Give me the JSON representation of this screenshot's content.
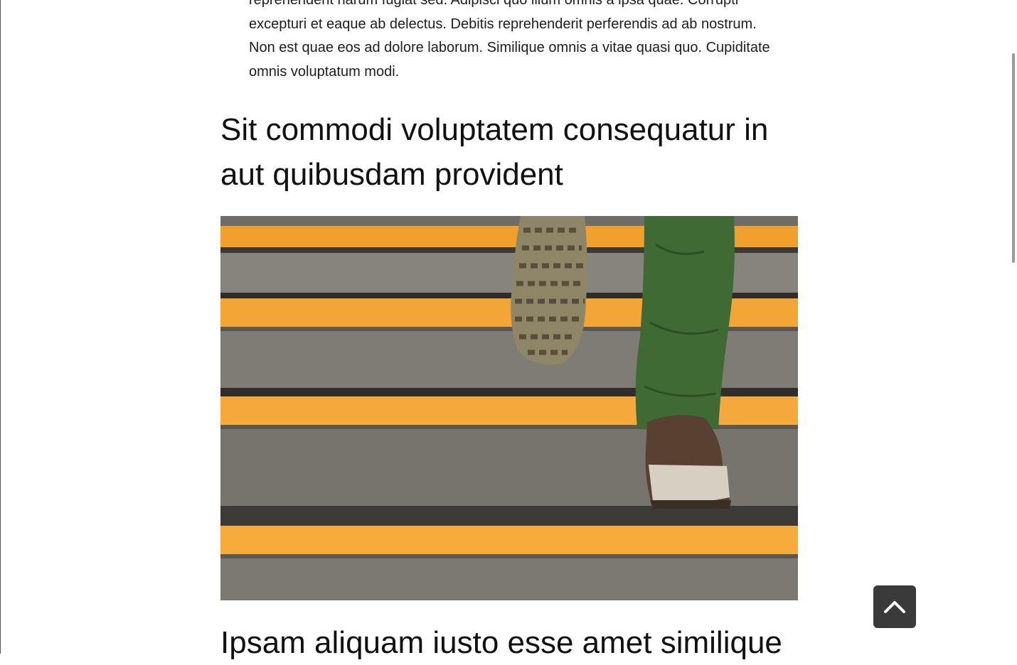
{
  "article": {
    "paragraph": "reprehenderit harum fugiat sed. Adipisci quo illum omnis a ipsa quae. Corrupti excepturi et eaque ab delectus. Debitis reprehenderit perferendis ad ab nostrum. Non est quae eos ad dolore laborum. Similique omnis a vitae quasi quo. Cupiditate omnis voluptatum modi.",
    "heading_1": "Sit commodi voluptatem consequatur in aut quibusdam provident",
    "heading_2": "Ipsam aliquam iusto esse amet similique"
  },
  "image": {
    "subject": "person walking up stairs with orange step edges"
  },
  "controls": {
    "scroll_top_icon": "chevron-up-icon"
  },
  "colors": {
    "stair_orange": "#f4a230",
    "stair_gray": "#7a7a73",
    "pants_green": "#3f6b35",
    "button_bg": "#3a3a3a"
  }
}
